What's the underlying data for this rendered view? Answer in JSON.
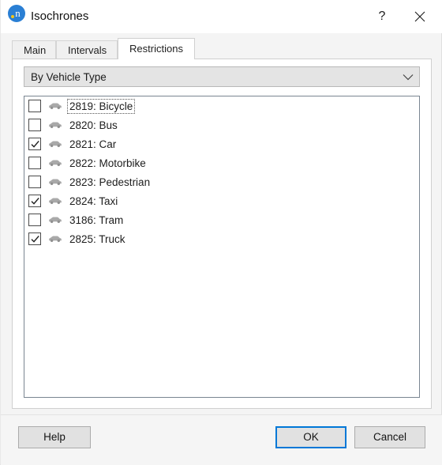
{
  "window": {
    "title": "Isochrones",
    "app_icon": "app-logo-n-icon",
    "help_label": "?",
    "close_label": "close-icon"
  },
  "tabs": [
    {
      "label": "Main",
      "active": false
    },
    {
      "label": "Intervals",
      "active": true
    },
    {
      "label": "Restrictions",
      "active": true
    }
  ],
  "tab_main": "Main",
  "tab_intervals": "Intervals",
  "tab_restrictions": "Restrictions",
  "filter": {
    "selected": "By Vehicle Type",
    "chevron": "chevron-down-icon"
  },
  "list": {
    "items": [
      {
        "label": "2819: Bicycle",
        "checked": false,
        "focused": true
      },
      {
        "label": "2820: Bus",
        "checked": false,
        "focused": false
      },
      {
        "label": "2821: Car",
        "checked": true,
        "focused": false
      },
      {
        "label": "2822: Motorbike",
        "checked": false,
        "focused": false
      },
      {
        "label": "2823: Pedestrian",
        "checked": false,
        "focused": false
      },
      {
        "label": "2824: Taxi",
        "checked": true,
        "focused": false
      },
      {
        "label": "3186: Tram",
        "checked": false,
        "focused": false
      },
      {
        "label": "2825: Truck",
        "checked": true,
        "focused": false
      }
    ]
  },
  "footer": {
    "help_label": "Help",
    "ok_label": "OK",
    "cancel_label": "Cancel"
  },
  "colors": {
    "accent": "#0078d7",
    "app_icon_bg": "#2a7fd4",
    "app_icon_dot": "#f5c518",
    "panel_bg": "#ffffff",
    "window_bg": "#f5f5f5",
    "listbox_border": "#7a8591"
  }
}
